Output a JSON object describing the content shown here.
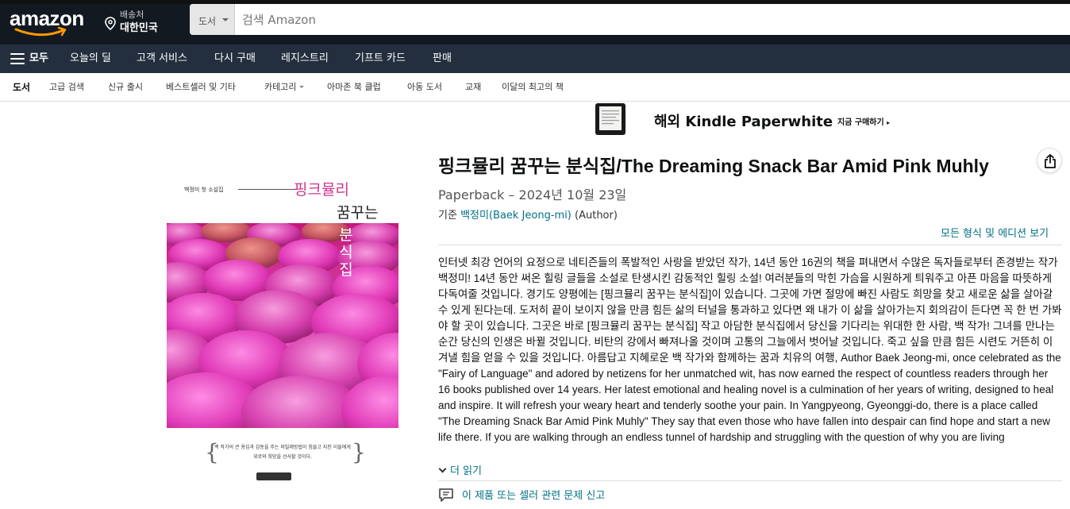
{
  "header": {
    "logo_text": "amazon",
    "deliver_line1": "배송처",
    "deliver_line2": "대한민국",
    "search_dept": "도서",
    "search_placeholder": "검색 Amazon"
  },
  "main_nav": {
    "all_label": "모두",
    "items": [
      "오늘의 딜",
      "고객 서비스",
      "다시 구매",
      "레지스트리",
      "기프트 카드",
      "판매"
    ]
  },
  "sub_nav": {
    "items": [
      "도서",
      "고급 검색",
      "신규 출시",
      "베스트셀러 및 기타",
      "카테고리",
      "아마존 북 클럽",
      "아동 도서",
      "교재",
      "이달의 최고의 책"
    ]
  },
  "kindle_banner": {
    "title": "해외 Kindle Paperwhite",
    "cta": "지금 구매하기"
  },
  "cover": {
    "author_line": "백정미 첫 소설집",
    "title_line1": "핑크뮬리",
    "title_line2": "꿈꾸는",
    "title_line3": "분식집",
    "blurb": "백 작가의 큰 용심과 감동을 주는 비밀레방법이 힘들고 지친 이들에게 위로와 희망을 선사할 것이다."
  },
  "product": {
    "title": "핑크뮬리 꿈꾸는 분식집/The Dreaming Snack Bar Amid Pink Muhly",
    "format": "Paperback – 2024년 10월 23일",
    "by_prefix": "기준",
    "author_name": "백정미(Baek Jeong-mi)",
    "author_role": "(Author)",
    "all_formats": "모든 형식 및 에디션 보기",
    "description": "인터넷 최강 언어의 요정으로 네티즌들의 폭발적인 사랑을 받았던 작가, 14년 동안 16권의 책을 펴내면서 수많은 독자들로부터 존경받는 작가 백정미! 14년 동안 써온 힐링 글들을 소설로 탄생시킨 감동적인 힐링 소설! 여러분들의 막힌 가슴을 시원하게 틔워주고 아픈 마음을 따뜻하게 다독여줄 것입니다. 경기도 양평에는 [핑크뮬리 꿈꾸는 분식집]이 있습니다. 그곳에 가면 절망에 빠진 사람도 희망을 찾고 새로운 삶을 살아갈 수 있게 된다는데. 도저히 끝이 보이지 않을 만큼 힘든 삶의 터널을 통과하고 있다면 왜 내가 이 삶을 살아가는지 회의감이 든다면 꼭 한 번 가봐야 할 곳이 있습니다. 그곳은 바로 [핑크뮬리 꿈꾸는 분식집] 작고 아담한 분식집에서 당신을 기다리는 위대한 한 사람, 백 작가! 그녀를 만나는 순간 당신의 인생은 바뀔 것입니다. 비탄의 강에서 빠져나올 것이며 고통의 그늘에서 벗어날 것입니다. 죽고 싶을 만큼 힘든 시련도 거뜬히 이겨낼 힘을 얻을 수 있을 것입니다. 아름답고 지혜로운 백 작가와 함께하는 꿈과 치유의 여행, Author Baek Jeong-mi, once celebrated as the \"Fairy of Language\" and adored by netizens for her unmatched wit, has now earned the respect of countless readers through her 16 books published over 14 years. Her latest emotional and healing novel is a culmination of her years of writing, designed to heal and inspire. It will refresh your weary heart and tenderly soothe your pain. In Yangpyeong, Gyeonggi-do, there is a place called \"The Dreaming Snack Bar Amid Pink Muhly\" They say that even those who have fallen into despair can find hope and start a new life there. If you are walking through an endless tunnel of hardship and struggling with the question of why you are living",
    "read_more": "더 읽기",
    "report": "이 제품 또는 셀러 관련 문제 신고"
  },
  "colors": {
    "nav_dark": "#131921",
    "nav_secondary": "#232f3e",
    "link": "#007185",
    "logo_orange": "#ff9900",
    "cover_pink": "#d0368c"
  }
}
